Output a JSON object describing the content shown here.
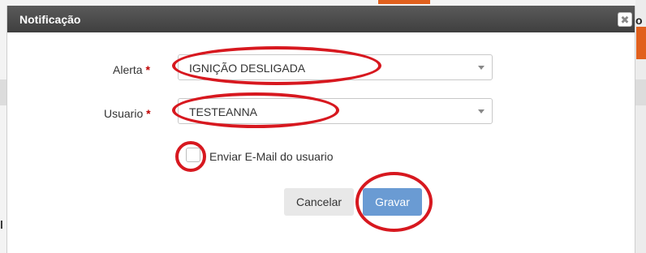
{
  "background": {
    "edge_text": "o",
    "left_char": "l"
  },
  "dialog": {
    "title": "Notificação",
    "close_glyph": "✖"
  },
  "form": {
    "alert": {
      "label": "Alerta",
      "required_mark": "*",
      "value": "IGNIÇÃO DESLIGADA"
    },
    "user": {
      "label": "Usuario",
      "required_mark": "*",
      "value": "TESTEANNA"
    },
    "email_checkbox": {
      "label": "Enviar E-Mail do usuario",
      "checked": false
    }
  },
  "buttons": {
    "cancel": "Cancelar",
    "save": "Gravar"
  },
  "colors": {
    "header": "#4a4a4a",
    "primary_button": "#6a9bd3",
    "required": "#c00000",
    "annotation": "#d7181f"
  }
}
